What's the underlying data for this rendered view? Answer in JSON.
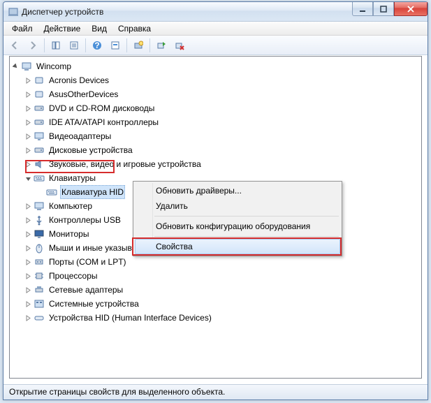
{
  "window": {
    "title": "Диспетчер устройств"
  },
  "menu": {
    "file": "Файл",
    "action": "Действие",
    "view": "Вид",
    "help": "Справка"
  },
  "tree": {
    "root": "Wincomp",
    "items": [
      "Acronis Devices",
      "AsusOtherDevices",
      "DVD и CD-ROM дисководы",
      "IDE ATA/ATAPI контроллеры",
      "Видеоадаптеры",
      "Дисковые устройства",
      "Звуковые, видео и игровые устройства"
    ],
    "keyboards": {
      "label": "Клавиатуры",
      "child": "Клавиатура HID"
    },
    "after": [
      "Компьютер",
      "Контроллеры USB",
      "Мониторы",
      "Мыши и иные указывающие устройства",
      "Порты (COM и LPT)",
      "Процессоры",
      "Сетевые адаптеры",
      "Системные устройства",
      "Устройства HID (Human Interface Devices)"
    ]
  },
  "ctx": {
    "update": "Обновить драйверы...",
    "delete": "Удалить",
    "scan": "Обновить конфигурацию оборудования",
    "props": "Свойства"
  },
  "status": "Открытие страницы свойств для выделенного объекта."
}
